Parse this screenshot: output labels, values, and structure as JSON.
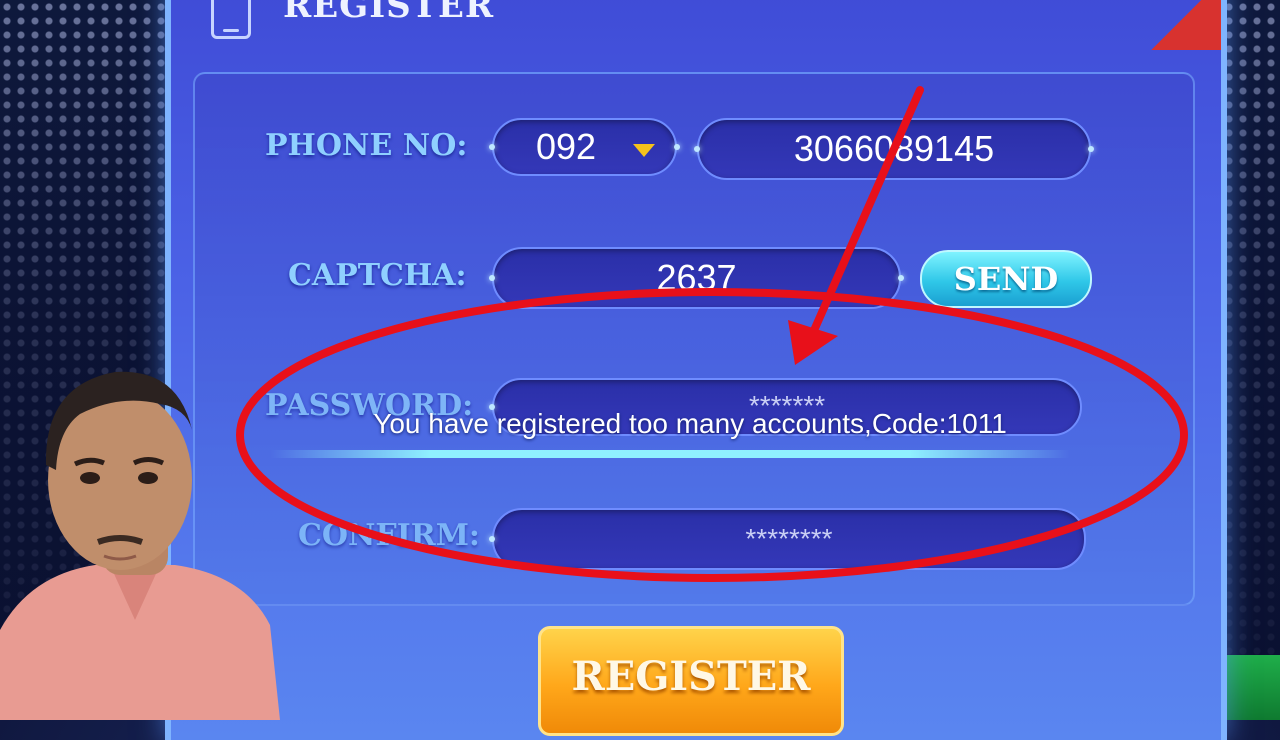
{
  "dialog": {
    "title": "REGISTER",
    "phone_label": "PHONE NO:",
    "country_code": "092",
    "phone_number": "3066089145",
    "captcha_label": "CAPTCHA:",
    "captcha_value": "2637",
    "send_label": "SEND",
    "password_label": "PASSWORD:",
    "password_value": "*******",
    "confirm_label": "CONFIRM:",
    "confirm_value": "********",
    "register_label": "REGISTER"
  },
  "toast": {
    "message": "You have registered too many accounts,Code:1011"
  },
  "colors": {
    "annotation": "#e8101a",
    "register_button": "#ffa71a",
    "send_button": "#2fc7e8",
    "label": "#8fd0ff"
  }
}
